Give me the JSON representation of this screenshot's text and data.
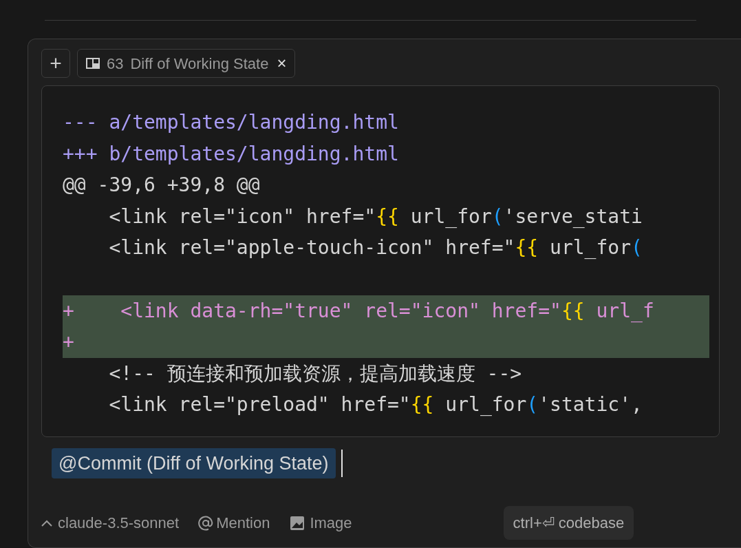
{
  "tab_bar": {
    "add_button": "+",
    "tabs": [
      {
        "number": "63",
        "label": "Diff of Working State",
        "close": "×",
        "selected": true
      }
    ]
  },
  "diff": {
    "lines": [
      {
        "kind": "header",
        "segments": [
          {
            "kind": "plain",
            "text": "--- a/templates/langding.html"
          }
        ]
      },
      {
        "kind": "header",
        "segments": [
          {
            "kind": "plain",
            "text": "+++ b/templates/langding.html"
          }
        ]
      },
      {
        "kind": "hunk",
        "segments": [
          {
            "kind": "plain",
            "text": "@@ -39,6 +39,8 @@"
          }
        ]
      },
      {
        "kind": "context",
        "segments": [
          {
            "kind": "plain",
            "text": "    <link rel=\"icon\" href=\""
          },
          {
            "kind": "brace",
            "text": "{{"
          },
          {
            "kind": "plain",
            "text": " url_for"
          },
          {
            "kind": "paren",
            "text": "("
          },
          {
            "kind": "plain",
            "text": "'serve_stati"
          }
        ]
      },
      {
        "kind": "context",
        "segments": [
          {
            "kind": "plain",
            "text": "    <link rel=\"apple-touch-icon\" href=\""
          },
          {
            "kind": "brace",
            "text": "{{"
          },
          {
            "kind": "plain",
            "text": " url_for"
          },
          {
            "kind": "paren",
            "text": "("
          }
        ]
      },
      {
        "kind": "blank"
      },
      {
        "kind": "added",
        "segments": [
          {
            "kind": "plain",
            "text": "+    <link data-rh=\"true\" rel=\"icon\" href=\""
          },
          {
            "kind": "brace",
            "text": "{{"
          },
          {
            "kind": "plain",
            "text": " url_f"
          }
        ]
      },
      {
        "kind": "added",
        "segments": [
          {
            "kind": "plain",
            "text": "+"
          }
        ]
      },
      {
        "kind": "context",
        "segments": [
          {
            "kind": "plain",
            "text": "    <!-- 预连接和预加载资源，提高加载速度 -->"
          }
        ]
      },
      {
        "kind": "context",
        "segments": [
          {
            "kind": "plain",
            "text": "    <link rel=\"preload\" href=\""
          },
          {
            "kind": "brace",
            "text": "{{"
          },
          {
            "kind": "plain",
            "text": " url_for"
          },
          {
            "kind": "paren",
            "text": "("
          },
          {
            "kind": "plain",
            "text": "'static',"
          }
        ]
      }
    ]
  },
  "input": {
    "mention_chip": "@Commit (Diff of Working State)"
  },
  "footer": {
    "model": "claude-3.5-sonnet",
    "mention": "Mention",
    "image": "Image",
    "submit": "ctrl+⏎ codebase"
  }
}
